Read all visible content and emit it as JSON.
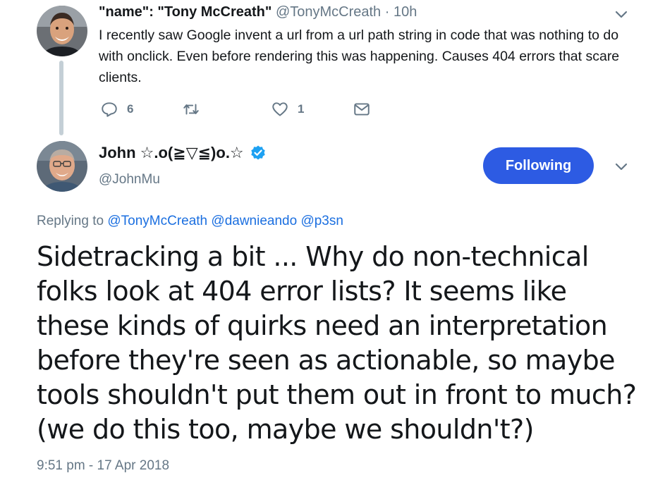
{
  "parent_tweet": {
    "avatar": "person-photo-avatar",
    "name": "\"name\": \"Tony McCreath\"",
    "handle": "@TonyMcCreath",
    "separator": "·",
    "time": "10h",
    "text": "I recently saw Google invent a url from a url path string in code that was nothing to do with onclick. Even before rendering this was happening. Causes 404 errors that scare clients.",
    "actions": {
      "reply_count": "6",
      "retweet_count": "",
      "like_count": "1",
      "reply_icon": "reply-icon",
      "retweet_icon": "retweet-icon",
      "like_icon": "heart-icon",
      "dm_icon": "envelope-icon"
    }
  },
  "main_tweet": {
    "avatar": "person-photo-avatar",
    "name": "John ☆.o(≧▽≦)o.☆",
    "verified_icon": "verified-badge-icon",
    "handle": "@JohnMu",
    "follow_button": "Following",
    "replying_prefix": "Replying to",
    "replying_to": [
      "@TonyMcCreath",
      "@dawnieando",
      "@p3sn"
    ],
    "text": "Sidetracking a bit ... Why do non-technical folks look at 404 error lists? It seems like these kinds of quirks need an interpretation before they're seen as actionable, so maybe tools shouldn't put them out in front to much? (we do this too, maybe we shouldn't?)",
    "timestamp": "9:51 pm - 17 Apr 2018"
  },
  "colors": {
    "secondary_text": "#657786",
    "link": "#1b6fe0",
    "follow_button": "#2d5be3",
    "verified": "#1da1f2",
    "thread_line": "#c4cfd6"
  }
}
